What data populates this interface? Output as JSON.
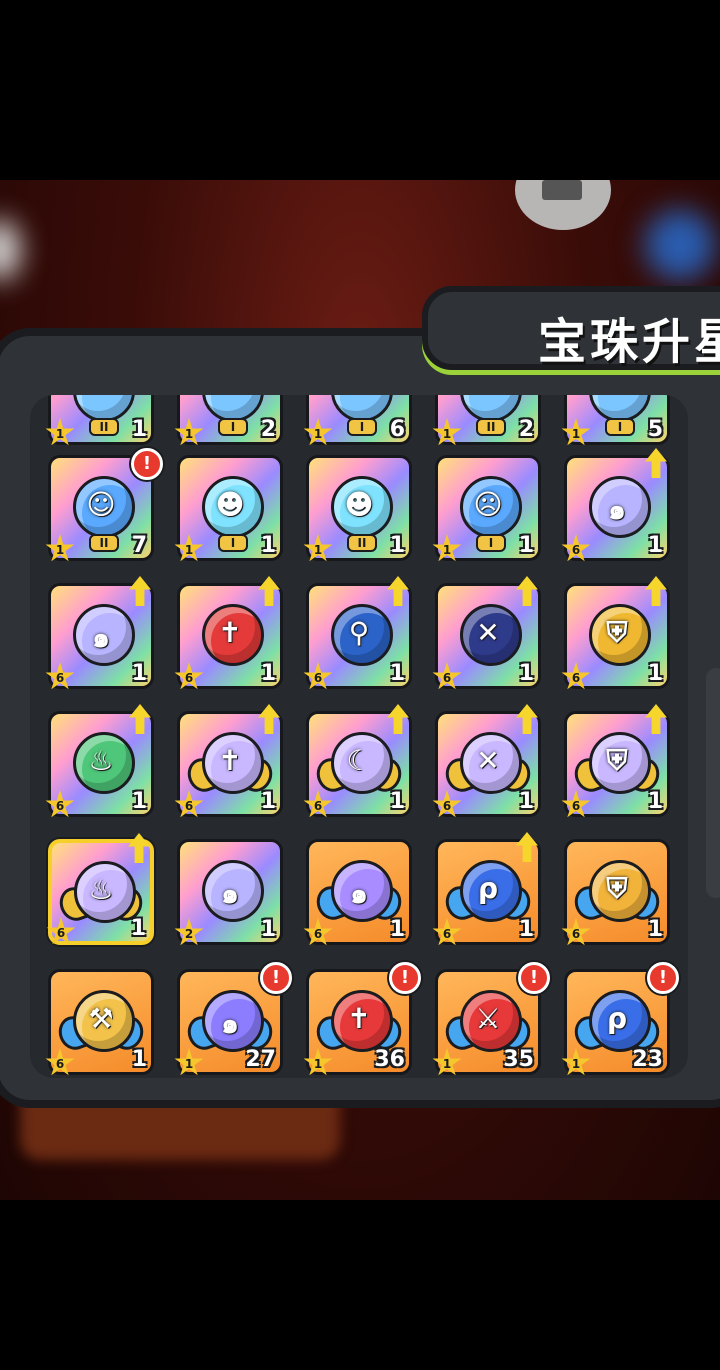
{
  "title": "宝珠升星",
  "colors": {
    "accent": "#9bd23a",
    "alert": "#e8392e",
    "star": "#f6c72c",
    "selected": "#f6cf2a"
  },
  "rows": [
    [
      {
        "bg": "rainbow",
        "orb": "#7cc6ff",
        "glyph": "",
        "roman": "II",
        "stars": "1",
        "count": "1"
      },
      {
        "bg": "rainbow",
        "orb": "#7cc6ff",
        "glyph": "",
        "roman": "I",
        "stars": "1",
        "count": "2"
      },
      {
        "bg": "rainbow",
        "orb": "#7cc6ff",
        "glyph": "",
        "roman": "I",
        "stars": "1",
        "count": "6"
      },
      {
        "bg": "rainbow",
        "orb": "#7cc6ff",
        "glyph": "",
        "roman": "II",
        "stars": "1",
        "count": "2"
      },
      {
        "bg": "rainbow",
        "orb": "#7cc6ff",
        "glyph": "",
        "roman": "I",
        "stars": "1",
        "count": "5"
      }
    ],
    [
      {
        "bg": "rainbow",
        "orb": "#5aa9ff",
        "glyph": "☺",
        "roman": "II",
        "stars": "1",
        "count": "7",
        "alert": "!",
        "icon": "maid-portrait-icon"
      },
      {
        "bg": "rainbow",
        "orb": "#7fe3ff",
        "glyph": "☻",
        "roman": "I",
        "stars": "1",
        "count": "1",
        "icon": "ghost-portrait-icon"
      },
      {
        "bg": "rainbow",
        "orb": "#7fe3ff",
        "glyph": "☻",
        "roman": "II",
        "stars": "1",
        "count": "1",
        "icon": "ghost-portrait-icon"
      },
      {
        "bg": "rainbow",
        "orb": "#5aa9ff",
        "glyph": "☹",
        "roman": "I",
        "stars": "1",
        "count": "1",
        "icon": "warrior-portrait-icon"
      },
      {
        "bg": "rainbow",
        "orb": "#b8b4ff",
        "glyph": "๑",
        "stars": "6",
        "count": "1",
        "up": true,
        "icon": "swirl-orb-icon"
      }
    ],
    [
      {
        "bg": "rainbow",
        "orb": "#b8b4ff",
        "glyph": "๑",
        "stars": "6",
        "count": "1",
        "up": true,
        "icon": "swirl-orb-icon"
      },
      {
        "bg": "rainbow",
        "orb": "#e43a3a",
        "glyph": "✝",
        "stars": "6",
        "count": "1",
        "up": true,
        "icon": "sword-orb-icon"
      },
      {
        "bg": "rainbow",
        "orb": "#2b63c9",
        "glyph": "⚲",
        "stars": "6",
        "count": "1",
        "up": true,
        "icon": "staff-orb-icon"
      },
      {
        "bg": "rainbow",
        "orb": "#2e3a8a",
        "glyph": "✕",
        "stars": "6",
        "count": "1",
        "up": true,
        "icon": "crossed-swords-orb-icon"
      },
      {
        "bg": "rainbow",
        "orb": "#f0b830",
        "glyph": "⛨",
        "stars": "6",
        "count": "1",
        "up": true,
        "icon": "shield-orb-icon"
      }
    ],
    [
      {
        "bg": "rainbow",
        "orb": "#4fc77a",
        "glyph": "♨",
        "stars": "6",
        "count": "1",
        "up": true,
        "icon": "leaf-flame-orb-icon"
      },
      {
        "bg": "rainbow",
        "orb": "#c9b7ff",
        "glyph": "✝",
        "stars": "6",
        "count": "1",
        "up": true,
        "wings": true,
        "icon": "winged-sword-orb-icon"
      },
      {
        "bg": "rainbow",
        "orb": "#c9b7ff",
        "glyph": "☾",
        "stars": "6",
        "count": "1",
        "up": true,
        "wings": true,
        "icon": "winged-moon-orb-icon"
      },
      {
        "bg": "rainbow",
        "orb": "#c9b7ff",
        "glyph": "✕",
        "stars": "6",
        "count": "1",
        "up": true,
        "wings": true,
        "icon": "winged-cross-orb-icon"
      },
      {
        "bg": "rainbow",
        "orb": "#c9b7ff",
        "glyph": "⛨",
        "stars": "6",
        "count": "1",
        "up": true,
        "wings": true,
        "icon": "winged-shield-orb-icon"
      }
    ],
    [
      {
        "bg": "rainbow",
        "orb": "#c9b7ff",
        "glyph": "♨",
        "stars": "6",
        "count": "1",
        "up": true,
        "wings": true,
        "selected": true,
        "icon": "winged-flame-orb-icon"
      },
      {
        "bg": "rainbow",
        "orb": "#b8b4ff",
        "glyph": "๑",
        "stars": "2",
        "count": "1",
        "icon": "swirl-orb-icon"
      },
      {
        "bg": "orange",
        "orb": "#a98cff",
        "glyph": "๑",
        "stars": "6",
        "count": "1",
        "wings": true,
        "icon": "swirl-wave-orb-icon"
      },
      {
        "bg": "orange",
        "orb": "#3a6ee8",
        "glyph": "ρ",
        "stars": "6",
        "count": "1",
        "up": true,
        "wings": true,
        "icon": "blue-rune-orb-icon"
      },
      {
        "bg": "orange",
        "orb": "#f2b33a",
        "glyph": "⛨",
        "stars": "6",
        "count": "1",
        "wings": true,
        "icon": "gold-shield-orb-icon"
      }
    ],
    [
      {
        "bg": "orange",
        "orb": "#f2c24a",
        "glyph": "⚒",
        "stars": "6",
        "count": "1",
        "wings": true,
        "icon": "hammer-orb-icon"
      },
      {
        "bg": "orange",
        "orb": "#8c7dff",
        "glyph": "๑",
        "stars": "1",
        "count": "27",
        "alert": "!",
        "wings": true,
        "icon": "swirl-wave-orb-icon"
      },
      {
        "bg": "orange",
        "orb": "#e8393a",
        "glyph": "✝",
        "stars": "1",
        "count": "36",
        "alert": "!",
        "wings": true,
        "icon": "red-sword-orb-icon"
      },
      {
        "bg": "orange",
        "orb": "#e8393a",
        "glyph": "⚔",
        "stars": "1",
        "count": "35",
        "alert": "!",
        "wings": true,
        "icon": "red-axe-orb-icon"
      },
      {
        "bg": "orange",
        "orb": "#3a6ee8",
        "glyph": "ρ",
        "stars": "1",
        "count": "23",
        "alert": "!",
        "wings": true,
        "icon": "blue-rune-orb-icon"
      }
    ]
  ]
}
